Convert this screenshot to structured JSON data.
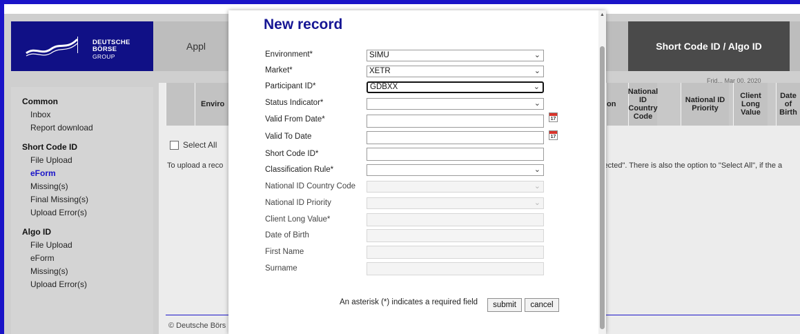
{
  "brand": {
    "logo_line1": "DEUTSCHE BÖRSE",
    "logo_line2": "GROUP",
    "brand_color": "#101086",
    "accent": "#1a14c8"
  },
  "header": {
    "app_label": "Appl",
    "active_tab": "Short Code ID / Algo ID"
  },
  "sidebar": {
    "sections": [
      {
        "title": "Common",
        "items": [
          {
            "label": "Inbox"
          },
          {
            "label": "Report download"
          }
        ]
      },
      {
        "title": "Short Code ID",
        "items": [
          {
            "label": "File Upload"
          },
          {
            "label": "eForm",
            "active": true
          },
          {
            "label": "Missing(s)"
          },
          {
            "label": "Final Missing(s)"
          },
          {
            "label": "Upload Error(s)"
          }
        ]
      },
      {
        "title": "Algo ID",
        "items": [
          {
            "label": "File Upload"
          },
          {
            "label": "eForm"
          },
          {
            "label": "Missing(s)"
          },
          {
            "label": "Upload Error(s)"
          }
        ]
      }
    ]
  },
  "table": {
    "date_label": "Frid... Mar 00, 2020",
    "headers": [
      "Enviro",
      "on",
      "National ID Country Code",
      "National ID Priority",
      "Client Long Value",
      "Date of Birth"
    ]
  },
  "background": {
    "select_all": "Select All",
    "upload_text": "To upload a reco",
    "upload_text_right": "elected\". There is also the option to \"Select All\", if the a",
    "copyright": "© Deutsche Börs"
  },
  "modal": {
    "title": "New record",
    "fields": [
      {
        "label": "Environment*",
        "value": "SIMU",
        "type": "select"
      },
      {
        "label": "Market*",
        "value": "XETR",
        "type": "select"
      },
      {
        "label": "Participant ID*",
        "value": "GDBXX",
        "type": "select"
      },
      {
        "label": "Status Indicator*",
        "value": "",
        "type": "select"
      },
      {
        "label": "Valid From Date*",
        "value": "",
        "type": "date"
      },
      {
        "label": "Valid To Date",
        "value": "",
        "type": "date"
      },
      {
        "label": "Short Code ID*",
        "value": "",
        "type": "text"
      },
      {
        "label": "Classification Rule*",
        "value": "",
        "type": "select"
      },
      {
        "label": "National ID Country Code",
        "value": "",
        "type": "select-disabled"
      },
      {
        "label": "National ID Priority",
        "value": "",
        "type": "select-disabled"
      },
      {
        "label": "Client Long Value*",
        "value": "",
        "type": "text-disabled"
      },
      {
        "label": "Date of Birth",
        "value": "",
        "type": "text-disabled"
      },
      {
        "label": "First Name",
        "value": "",
        "type": "text-disabled"
      },
      {
        "label": "Surname",
        "value": "",
        "type": "text-disabled"
      }
    ],
    "calendar_icon_num": "17",
    "required_note": "An asterisk (*) indicates a required field",
    "submit_label": "submit",
    "cancel_label": "cancel"
  }
}
